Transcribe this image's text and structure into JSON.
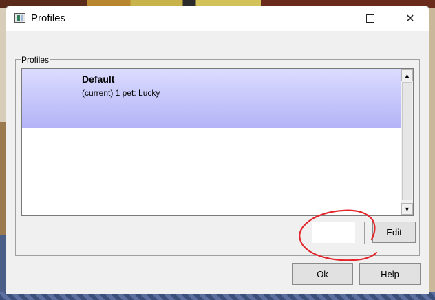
{
  "window": {
    "title": "Profiles"
  },
  "titlebar": {
    "minimize_icon": "minimize-icon",
    "maximize_icon": "maximize-icon",
    "close_icon": "close-icon",
    "close_glyph": "✕"
  },
  "group": {
    "label": "Profiles"
  },
  "profiles": [
    {
      "name": "Default",
      "description": "(current) 1 pet: Lucky",
      "selected": true
    }
  ],
  "scrollbar": {
    "up_glyph": "▲",
    "down_glyph": "▼"
  },
  "buttons": {
    "edit": "Edit",
    "ok": "Ok",
    "help": "Help"
  },
  "colors": {
    "selection_top": "#dcdcff",
    "selection_bottom": "#b3b3f7",
    "annotation": "#e3262c"
  }
}
